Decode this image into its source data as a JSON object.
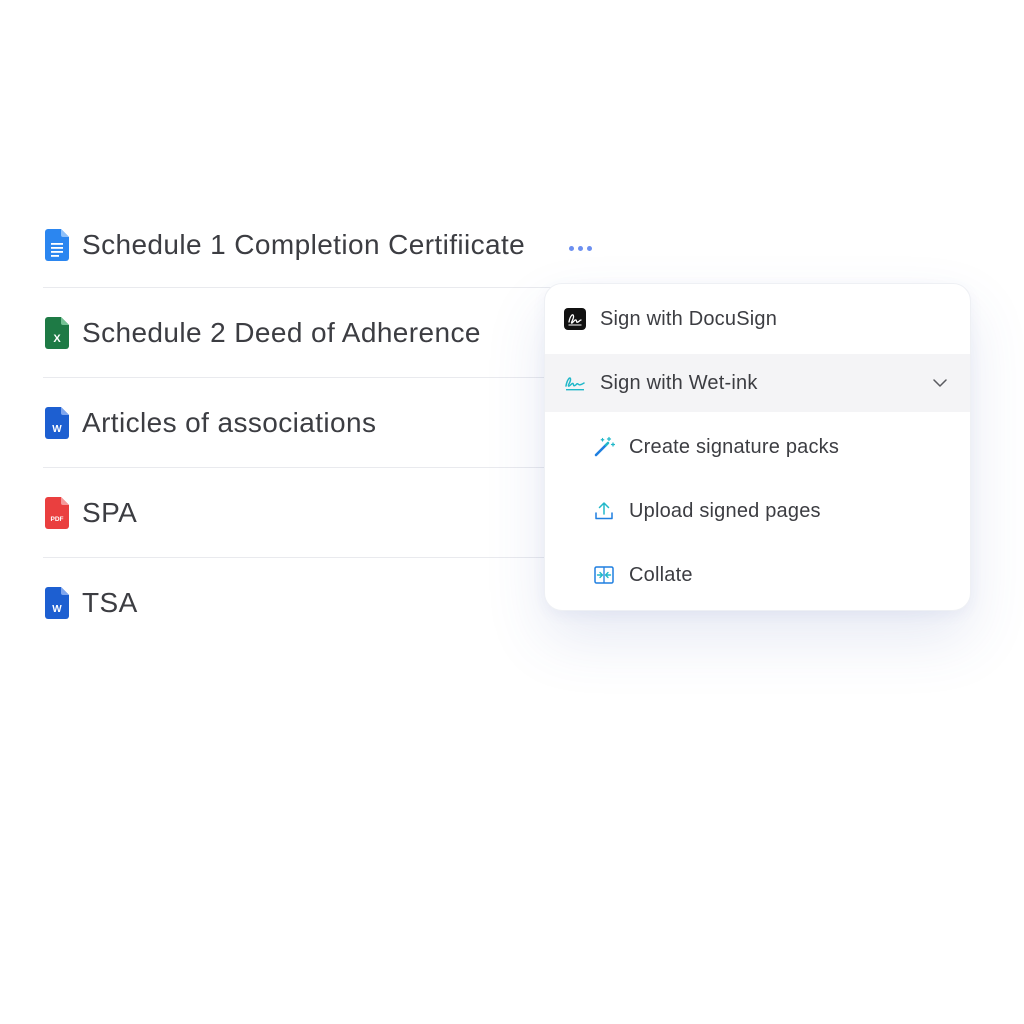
{
  "documents": [
    {
      "name": "Schedule 1 Completion Certifiicate",
      "icon": "google-doc-icon",
      "color": "#2b86f0"
    },
    {
      "name": "Schedule 2 Deed of Adherence",
      "icon": "excel-icon",
      "color": "#1e7a45"
    },
    {
      "name": "Articles of associations",
      "icon": "word-icon",
      "color": "#1d5fd1"
    },
    {
      "name": "SPA",
      "icon": "pdf-icon",
      "color": "#ea3f3f"
    },
    {
      "name": "TSA",
      "icon": "word-icon",
      "color": "#1d5fd1"
    }
  ],
  "file_badges": {
    "excel": "X",
    "word": "W",
    "pdf": "PDF"
  },
  "more_button": {
    "icon": "more-dots-icon",
    "color": "#6c8ff0"
  },
  "menu": {
    "docusign": {
      "label": "Sign with DocuSign",
      "icon": "docusign-icon"
    },
    "wetink": {
      "label": "Sign with Wet-ink",
      "icon": "signature-icon",
      "expanded": true
    },
    "submenu": [
      {
        "label": "Create signature packs",
        "icon": "magic-wand-icon"
      },
      {
        "label": "Upload signed pages",
        "icon": "upload-icon"
      },
      {
        "label": "Collate",
        "icon": "collate-icon"
      }
    ]
  },
  "colors": {
    "accent": "#6c8ff0",
    "teal": "#22b8c9",
    "text": "#3c3d42",
    "active_bg": "#f4f4f6"
  }
}
